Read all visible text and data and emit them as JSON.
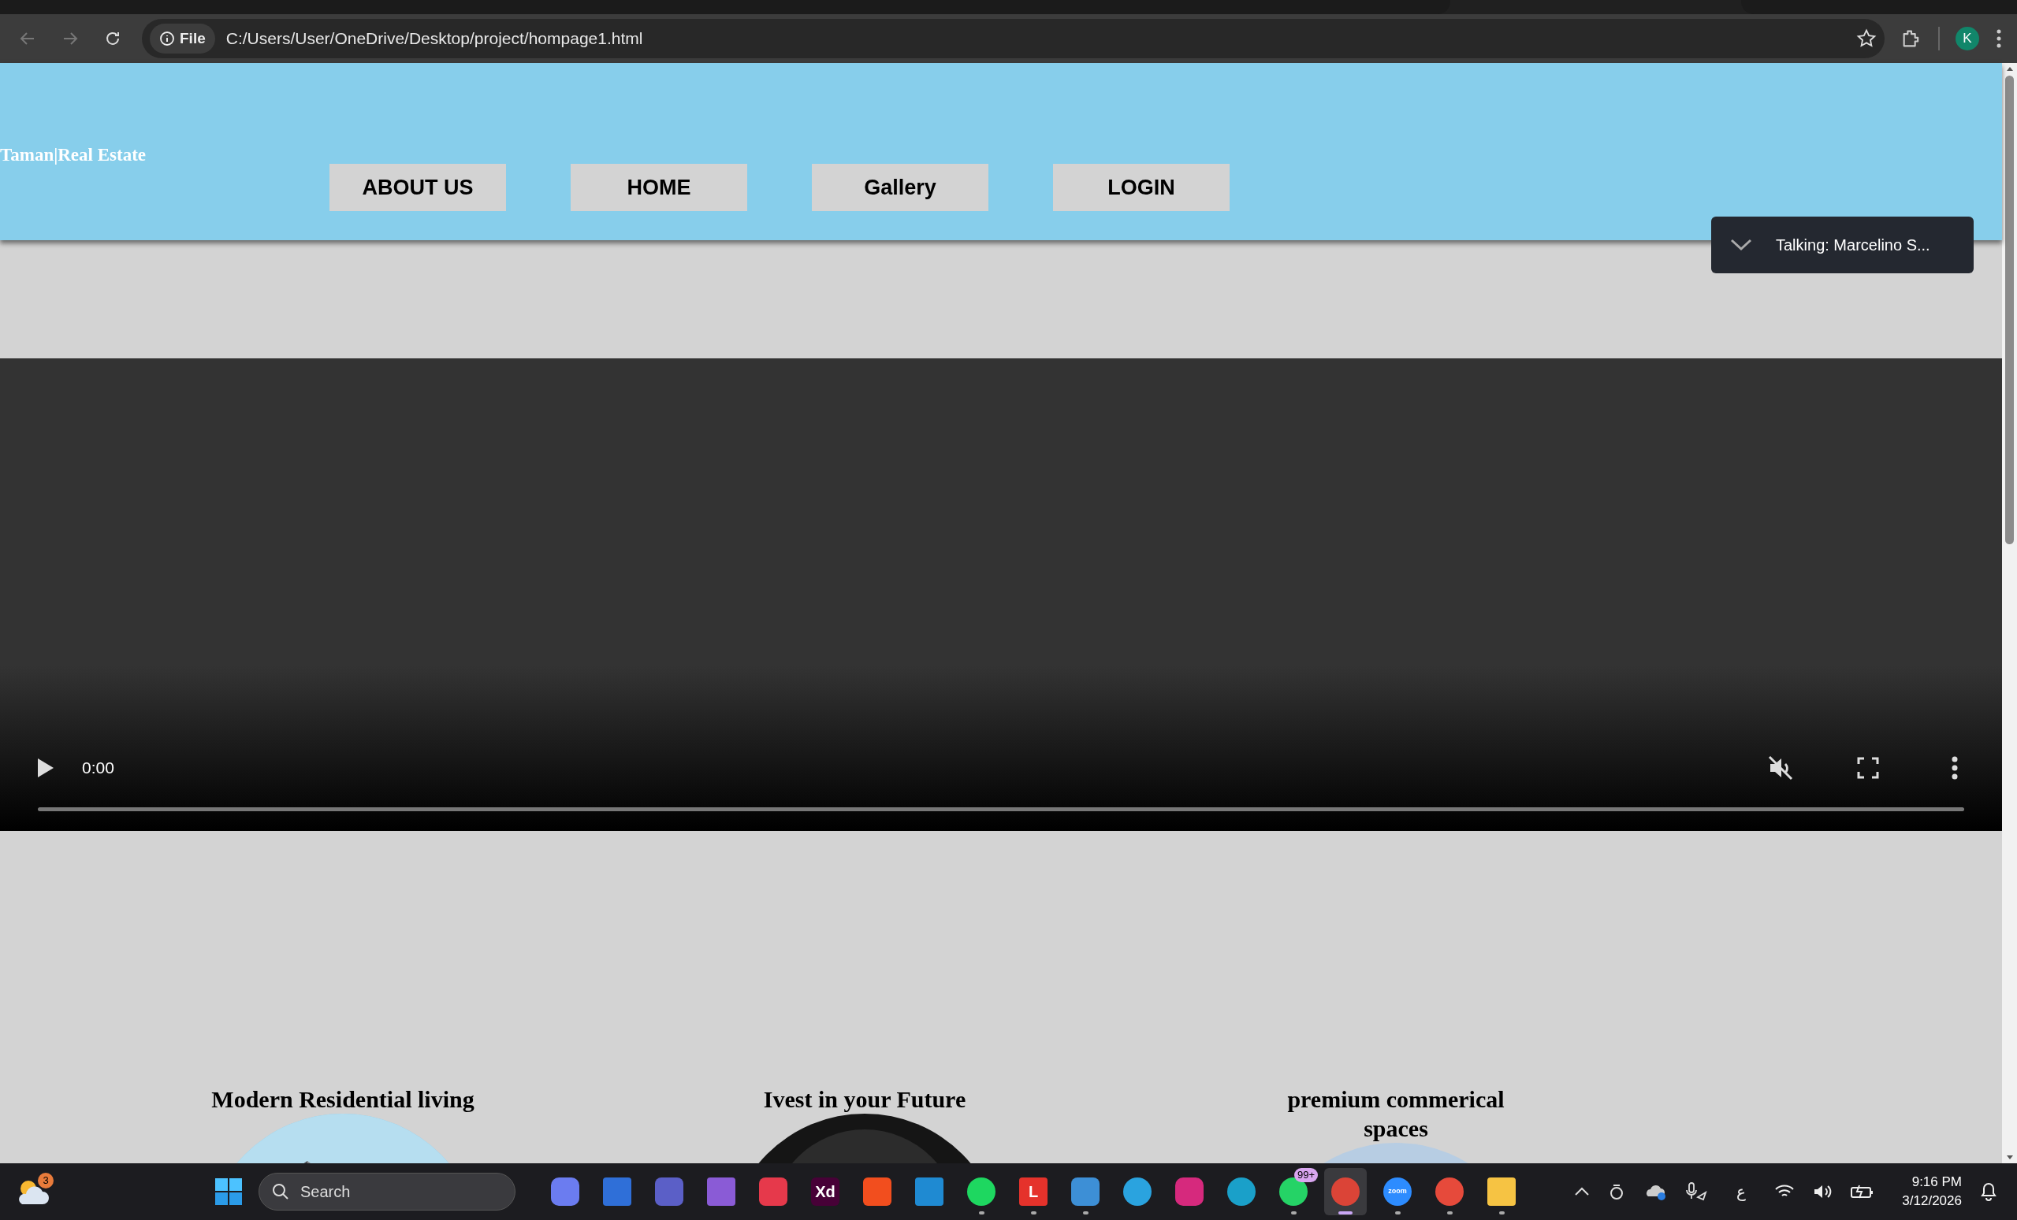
{
  "browser": {
    "url_badge": "File",
    "url": "C:/Users/User/OneDrive/Desktop/project/hompage1.html",
    "avatar": "K",
    "bookmarked": false
  },
  "header": {
    "logo": "Taman|Real Estate",
    "nav": [
      {
        "label": "ABOUT US"
      },
      {
        "label": "HOME"
      },
      {
        "label": "Gallery"
      },
      {
        "label": "LOGIN"
      }
    ]
  },
  "toast": {
    "text": "Talking: Marcelino S..."
  },
  "video": {
    "time": "0:00",
    "muted": true
  },
  "cards": [
    {
      "title": "Modern Residential living",
      "kind": "picture"
    },
    {
      "title": "Ivest in your Future",
      "kind": "picture"
    },
    {
      "title": "premium commerical spaces",
      "kind": "picture"
    }
  ],
  "taskbar": {
    "weather_badge": "3",
    "search": "Search",
    "apps": [
      {
        "kind": "copilot",
        "running": false
      },
      {
        "kind": "store",
        "running": false
      },
      {
        "kind": "teams",
        "running": false
      },
      {
        "kind": "vstudio",
        "running": false
      },
      {
        "kind": "cloud",
        "running": false
      },
      {
        "kind": "xd",
        "text": "Xd",
        "running": false
      },
      {
        "kind": "figma",
        "running": false
      },
      {
        "kind": "vscode",
        "running": false
      },
      {
        "kind": "spotify",
        "running": true
      },
      {
        "kind": "letter",
        "text": "L",
        "running": true
      },
      {
        "kind": "m365",
        "running": true
      },
      {
        "kind": "telegram",
        "running": false
      },
      {
        "kind": "instagram",
        "running": false
      },
      {
        "kind": "edge",
        "running": false
      },
      {
        "kind": "whatsapp",
        "badge": "99+",
        "running": true
      },
      {
        "kind": "chrome",
        "running": true,
        "selected": true
      },
      {
        "kind": "zoom",
        "text": "zoom",
        "running": true
      },
      {
        "kind": "planet",
        "running": true
      },
      {
        "kind": "folder",
        "running": true
      }
    ],
    "keyboard": "ع",
    "time": "9:16 PM",
    "date": "3/12/2026"
  }
}
